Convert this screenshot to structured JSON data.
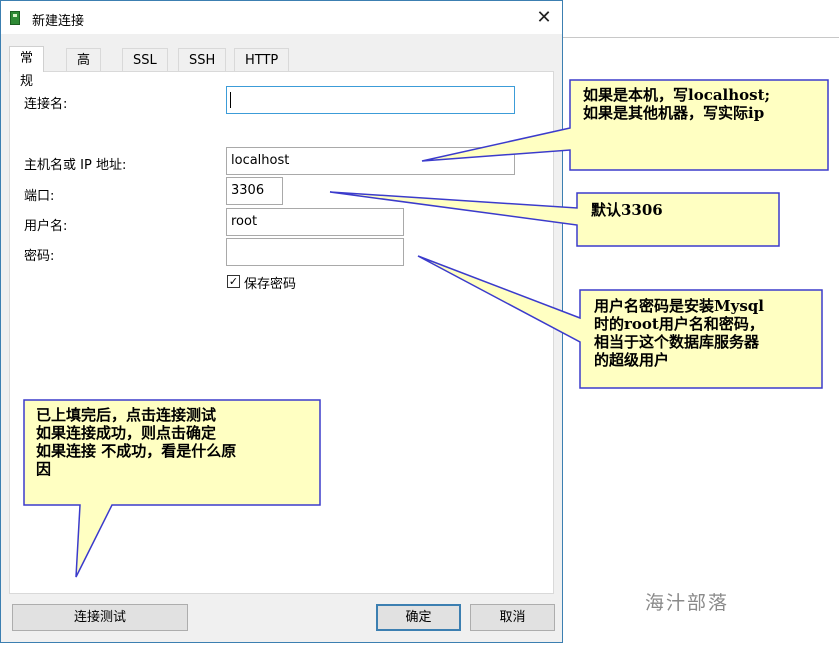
{
  "dialog": {
    "title": "新建连接",
    "close_glyph": "✕",
    "icon": "database-icon"
  },
  "tabs": [
    {
      "label": "常规",
      "active": true
    },
    {
      "label": "高级",
      "active": false
    },
    {
      "label": "SSL",
      "active": false
    },
    {
      "label": "SSH",
      "active": false
    },
    {
      "label": "HTTP",
      "active": false
    }
  ],
  "form": {
    "connection_name_label": "连接名:",
    "connection_name_value": "",
    "host_label": "主机名或 IP 地址:",
    "host_value": "localhost",
    "port_label": "端口:",
    "port_value": "3306",
    "user_label": "用户名:",
    "user_value": "root",
    "password_label": "密码:",
    "password_value": "",
    "save_password_label": "保存密码",
    "save_password_checked": "✓"
  },
  "buttons": {
    "test": "连接测试",
    "ok": "确定",
    "cancel": "取消"
  },
  "notes": {
    "host_line1": "如果是本机，写localhost;",
    "host_line2": "如果是其他机器，写实际ip",
    "port": "默认3306",
    "user_line1": "用户名密码是安装Mysql",
    "user_line2": "时的root用户名和密码，",
    "user_line3": "相当于这个数据库服务器",
    "user_line4": "的超级用户",
    "test_line1": "已上填完后，点击连接测试",
    "test_line2": "如果连接成功，则点击确定",
    "test_line3": "如果连接 不成功，看是什么原",
    "test_line4": "因"
  },
  "colors": {
    "note_fill": "#ffffc2",
    "note_border": "#3b3bcc",
    "accent": "#3c7fb1"
  },
  "watermark": "海汁部落"
}
